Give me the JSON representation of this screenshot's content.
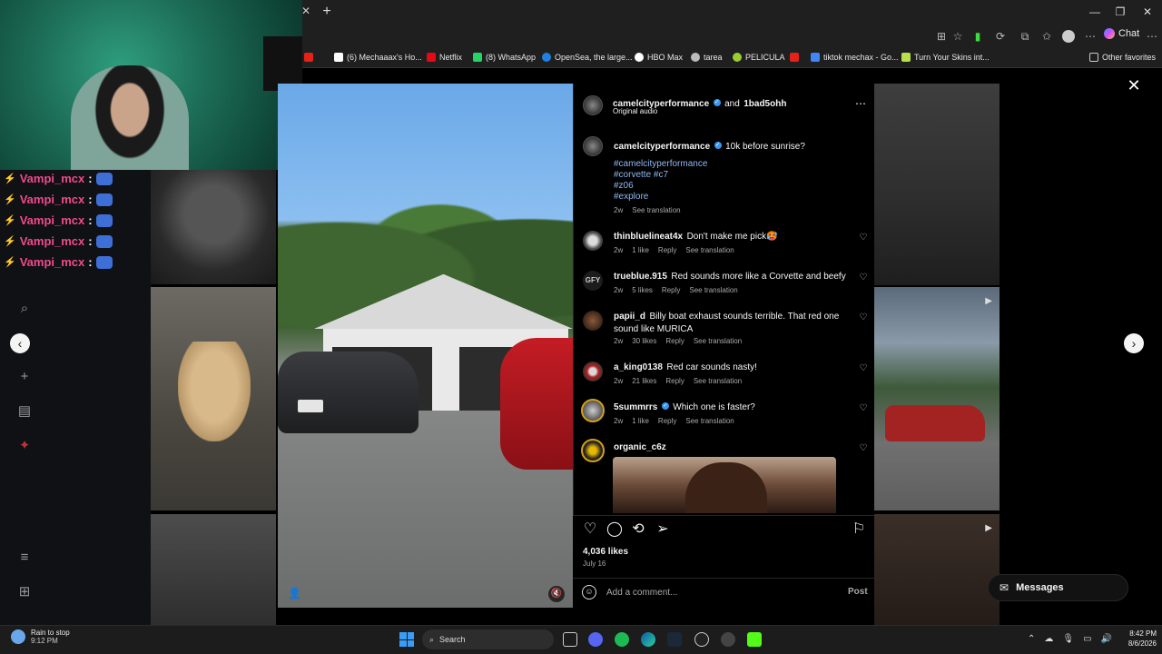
{
  "browser": {
    "bookmarks": [
      {
        "label": "(6) Mechaaax's Ho...",
        "color": "#ffffff"
      },
      {
        "label": "Netflix",
        "color": "#e50914"
      },
      {
        "label": "(8) WhatsApp",
        "color": "#25d366"
      },
      {
        "label": "OpenSea, the large...",
        "color": "#2081e2"
      },
      {
        "label": "HBO Max",
        "color": "#ffffff"
      },
      {
        "label": "tarea",
        "color": "#bbbbbb"
      },
      {
        "label": "PELICULA",
        "color": "#9acd32"
      },
      {
        "label": "tiktok mechax - Go...",
        "color": "#4285f4"
      },
      {
        "label": "Turn Your Skins int...",
        "color": "#b8e04a"
      }
    ],
    "other_favorites": "Other favorites",
    "chat_label": "Chat"
  },
  "stream_chat": {
    "lines": [
      {
        "user": "Vampi_mcx",
        "sep": ":"
      },
      {
        "user": "Vampi_mcx",
        "sep": ":"
      },
      {
        "user": "Vampi_mcx",
        "sep": ":"
      },
      {
        "user": "Vampi_mcx",
        "sep": ":"
      },
      {
        "user": "Vampi_mcx",
        "sep": ":"
      }
    ]
  },
  "post": {
    "author": "camelcityperformance",
    "and_text": "and",
    "collaborator": "1bad5ohh",
    "audio": "Original audio",
    "caption": {
      "user": "camelcityperformance",
      "text": "10k before sunrise?",
      "hashtags": [
        "#camelcityperformance",
        "#corvette #c7",
        "#z06",
        "#explore"
      ],
      "age": "2w",
      "translate": "See translation"
    },
    "comments": [
      {
        "user": "thinbluelineat4x",
        "text": "Don't make me pick🥵",
        "age": "2w",
        "likes": "1 like",
        "reply": "Reply",
        "translate": "See translation"
      },
      {
        "user": "trueblue.915",
        "text": "Red sounds more like a Corvette and beefy",
        "age": "2w",
        "likes": "5 likes",
        "reply": "Reply",
        "translate": "See translation"
      },
      {
        "user": "papii_d",
        "text": "Billy boat exhaust sounds terrible. That red one sound like MURICA",
        "age": "2w",
        "likes": "30 likes",
        "reply": "Reply",
        "translate": "See translation"
      },
      {
        "user": "a_king0138",
        "text": "Red car sounds nasty!",
        "age": "2w",
        "likes": "21 likes",
        "reply": "Reply",
        "translate": "See translation"
      },
      {
        "user": "5summrrs",
        "text": "Which one is faster?",
        "age": "2w",
        "likes": "1 like",
        "reply": "Reply",
        "translate": "See translation"
      },
      {
        "user": "organic_c6z",
        "text": ""
      }
    ],
    "likes": "4,036 likes",
    "date": "July 16",
    "comment_placeholder": "Add a comment...",
    "post_label": "Post"
  },
  "messages_label": "Messages",
  "taskbar": {
    "weather_line1": "Rain to stop",
    "weather_line2": "9:12 PM",
    "search_label": "Search",
    "time": "8:42 PM",
    "date": "8/6/2026"
  },
  "colors": {
    "accent_blue": "#3797f0",
    "chat_name": "#f04a8c",
    "hashtag": "#8fb8f0"
  }
}
